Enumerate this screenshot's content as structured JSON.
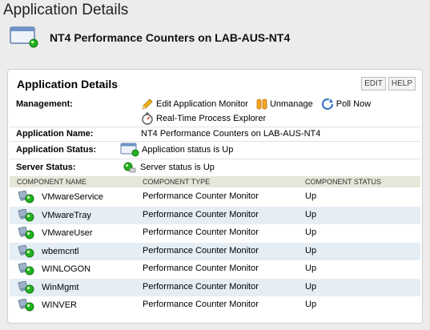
{
  "page": {
    "title": "Application Details"
  },
  "app_header": {
    "title": "NT4 Performance Counters on LAB-AUS-NT4",
    "icon": "application-window-icon"
  },
  "panel": {
    "title": "Application Details",
    "buttons": {
      "edit": "EDIT",
      "help": "HELP"
    },
    "management": {
      "label": "Management:",
      "links": {
        "edit_monitor": "Edit Application Monitor",
        "unmanage": "Unmanage",
        "poll_now": "Poll Now",
        "process_explorer": "Real-Time Process Explorer"
      }
    },
    "app_name": {
      "label": "Application Name:",
      "value": "NT4 Performance Counters on LAB-AUS-NT4"
    },
    "app_status": {
      "label": "Application Status:",
      "value": "Application status is Up"
    },
    "server_status": {
      "label": "Server Status:",
      "value": "Server status is Up"
    }
  },
  "components_table": {
    "headers": {
      "name": "COMPONENT NAME",
      "type": "COMPONENT TYPE",
      "status": "COMPONENT STATUS"
    },
    "rows": [
      {
        "name": "VMwareService",
        "type": "Performance Counter Monitor",
        "status": "Up"
      },
      {
        "name": "VMwareTray",
        "type": "Performance Counter Monitor",
        "status": "Up"
      },
      {
        "name": "VMwareUser",
        "type": "Performance Counter Monitor",
        "status": "Up"
      },
      {
        "name": "wbemcntl",
        "type": "Performance Counter Monitor",
        "status": "Up"
      },
      {
        "name": "WINLOGON",
        "type": "Performance Counter Monitor",
        "status": "Up"
      },
      {
        "name": "WinMgmt",
        "type": "Performance Counter Monitor",
        "status": "Up"
      },
      {
        "name": "WINVER",
        "type": "Performance Counter Monitor",
        "status": "Up"
      }
    ]
  },
  "colors": {
    "status_up": "#1aa51a",
    "row_alt": "#e6eef5",
    "header_bg": "#e6e6d9"
  }
}
